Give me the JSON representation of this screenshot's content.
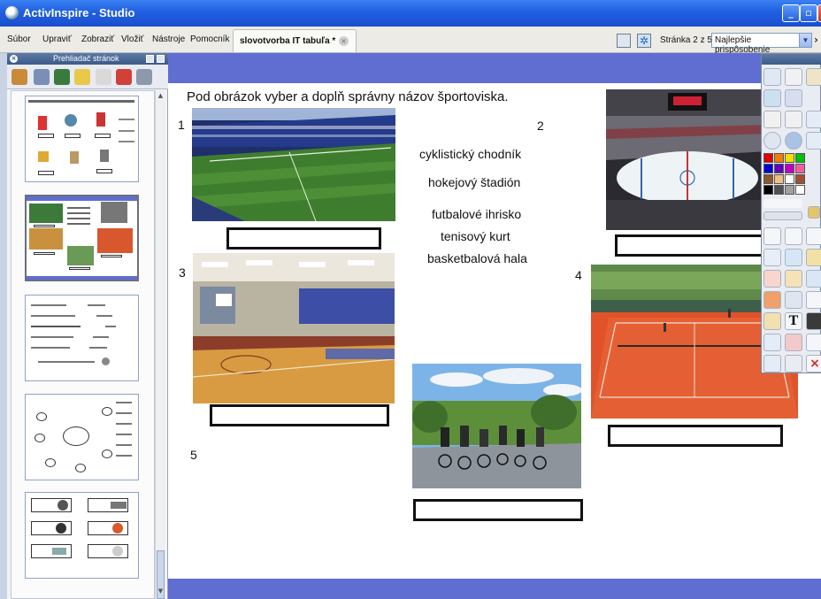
{
  "window": {
    "title": "ActivInspire - Studio"
  },
  "menu": [
    "Súbor",
    "Upraviť",
    "Zobraziť",
    "Vložiť",
    "Nástroje",
    "Pomocník"
  ],
  "doc_tab": {
    "label": "slovotvorba IT tabuľa *"
  },
  "page_indicator": "Stránka 2 z 5",
  "zoom": {
    "selected": "Najlepšie prispôsobenie"
  },
  "browser": {
    "title": "Prehliadač stránok"
  },
  "lesson": {
    "instruction": "Pod obrázok  vyber a  doplň správny názov športoviska.",
    "numbers": [
      "1",
      "2",
      "3",
      "4",
      "5"
    ],
    "options": [
      "cyklistický chodník",
      "hokejový štadión",
      "futbalové ihrisko",
      "tenisový kurt",
      "basketbalová hala"
    ]
  },
  "icons": [
    "app-icon",
    "minimize-icon",
    "maximize-icon",
    "close-icon",
    "page-icon",
    "snowflake-icon",
    "chevron-down-icon",
    "chevron-right-icon"
  ],
  "colors": {
    "band": "#5f6ed0",
    "titlebar": "#1f5fe0",
    "tennis_court": "#e2522a",
    "basketball_floor": "#d89b42"
  }
}
